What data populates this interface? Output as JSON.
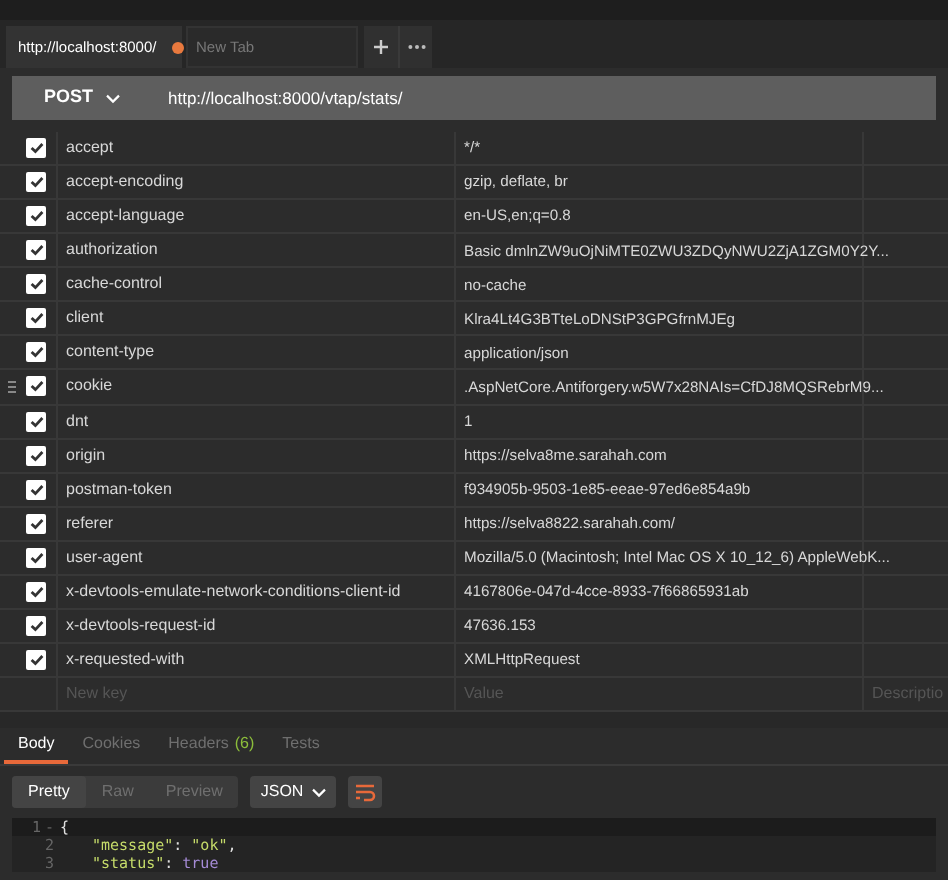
{
  "tabs": [
    {
      "label": "http://localhost:8000/",
      "selected": true,
      "unsaved": true
    },
    {
      "label": "New Tab",
      "selected": false,
      "unsaved": false
    }
  ],
  "request": {
    "method": "POST",
    "url": "http://localhost:8000/vtap/stats/"
  },
  "headers": [
    {
      "key": "accept",
      "value": "*/*",
      "checked": true
    },
    {
      "key": "accept-encoding",
      "value": "gzip, deflate, br",
      "checked": true
    },
    {
      "key": "accept-language",
      "value": "en-US,en;q=0.8",
      "checked": true
    },
    {
      "key": "authorization",
      "value": "Basic dmlnZW9uOjNiMTE0ZWU3ZDQyNWU2ZjA1ZGM0Y2Y...",
      "checked": true
    },
    {
      "key": "cache-control",
      "value": "no-cache",
      "checked": true
    },
    {
      "key": "client",
      "value": "Klra4Lt4G3BTteLoDNStP3GPGfrnMJEg",
      "checked": true
    },
    {
      "key": "content-type",
      "value": "application/json",
      "checked": true
    },
    {
      "key": "cookie",
      "value": ".AspNetCore.Antiforgery.w5W7x28NAIs=CfDJ8MQSRebrM9...",
      "checked": true,
      "hovered": true
    },
    {
      "key": "dnt",
      "value": "1",
      "checked": true
    },
    {
      "key": "origin",
      "value": "https://selva8me.sarahah.com",
      "checked": true
    },
    {
      "key": "postman-token",
      "value": "f934905b-9503-1e85-eeae-97ed6e854a9b",
      "checked": true
    },
    {
      "key": "referer",
      "value": "https://selva8822.sarahah.com/",
      "checked": true
    },
    {
      "key": "user-agent",
      "value": "Mozilla/5.0 (Macintosh; Intel Mac OS X 10_12_6) AppleWebK...",
      "checked": true
    },
    {
      "key": "x-devtools-emulate-network-conditions-client-id",
      "value": "4167806e-047d-4cce-8933-7f66865931ab",
      "checked": true
    },
    {
      "key": "x-devtools-request-id",
      "value": "47636.153",
      "checked": true
    },
    {
      "key": "x-requested-with",
      "value": "XMLHttpRequest",
      "checked": true
    }
  ],
  "new_row": {
    "key_placeholder": "New key",
    "value_placeholder": "Value",
    "description_placeholder": "Descriptio"
  },
  "response_tabs": [
    {
      "label": "Body",
      "selected": true
    },
    {
      "label": "Cookies",
      "selected": false
    },
    {
      "label": "Headers",
      "count": "(6)",
      "selected": false
    },
    {
      "label": "Tests",
      "selected": false
    }
  ],
  "view_modes": [
    {
      "label": "Pretty",
      "selected": true
    },
    {
      "label": "Raw",
      "selected": false
    },
    {
      "label": "Preview",
      "selected": false
    }
  ],
  "format": "JSON",
  "code_lines": [
    {
      "number": "1",
      "fold_toggle": "-",
      "tokens": [
        {
          "kind": "punct",
          "text": "{"
        }
      ]
    },
    {
      "number": "2",
      "tokens": [
        {
          "kind": "key",
          "text": "\"message\""
        },
        {
          "kind": "punct",
          "text": ": "
        },
        {
          "kind": "string",
          "text": "\"ok\""
        },
        {
          "kind": "punct",
          "text": ","
        }
      ]
    },
    {
      "number": "3",
      "tokens": [
        {
          "kind": "key",
          "text": "\"status\""
        },
        {
          "kind": "punct",
          "text": ": "
        },
        {
          "kind": "bool",
          "text": "true"
        }
      ]
    }
  ]
}
